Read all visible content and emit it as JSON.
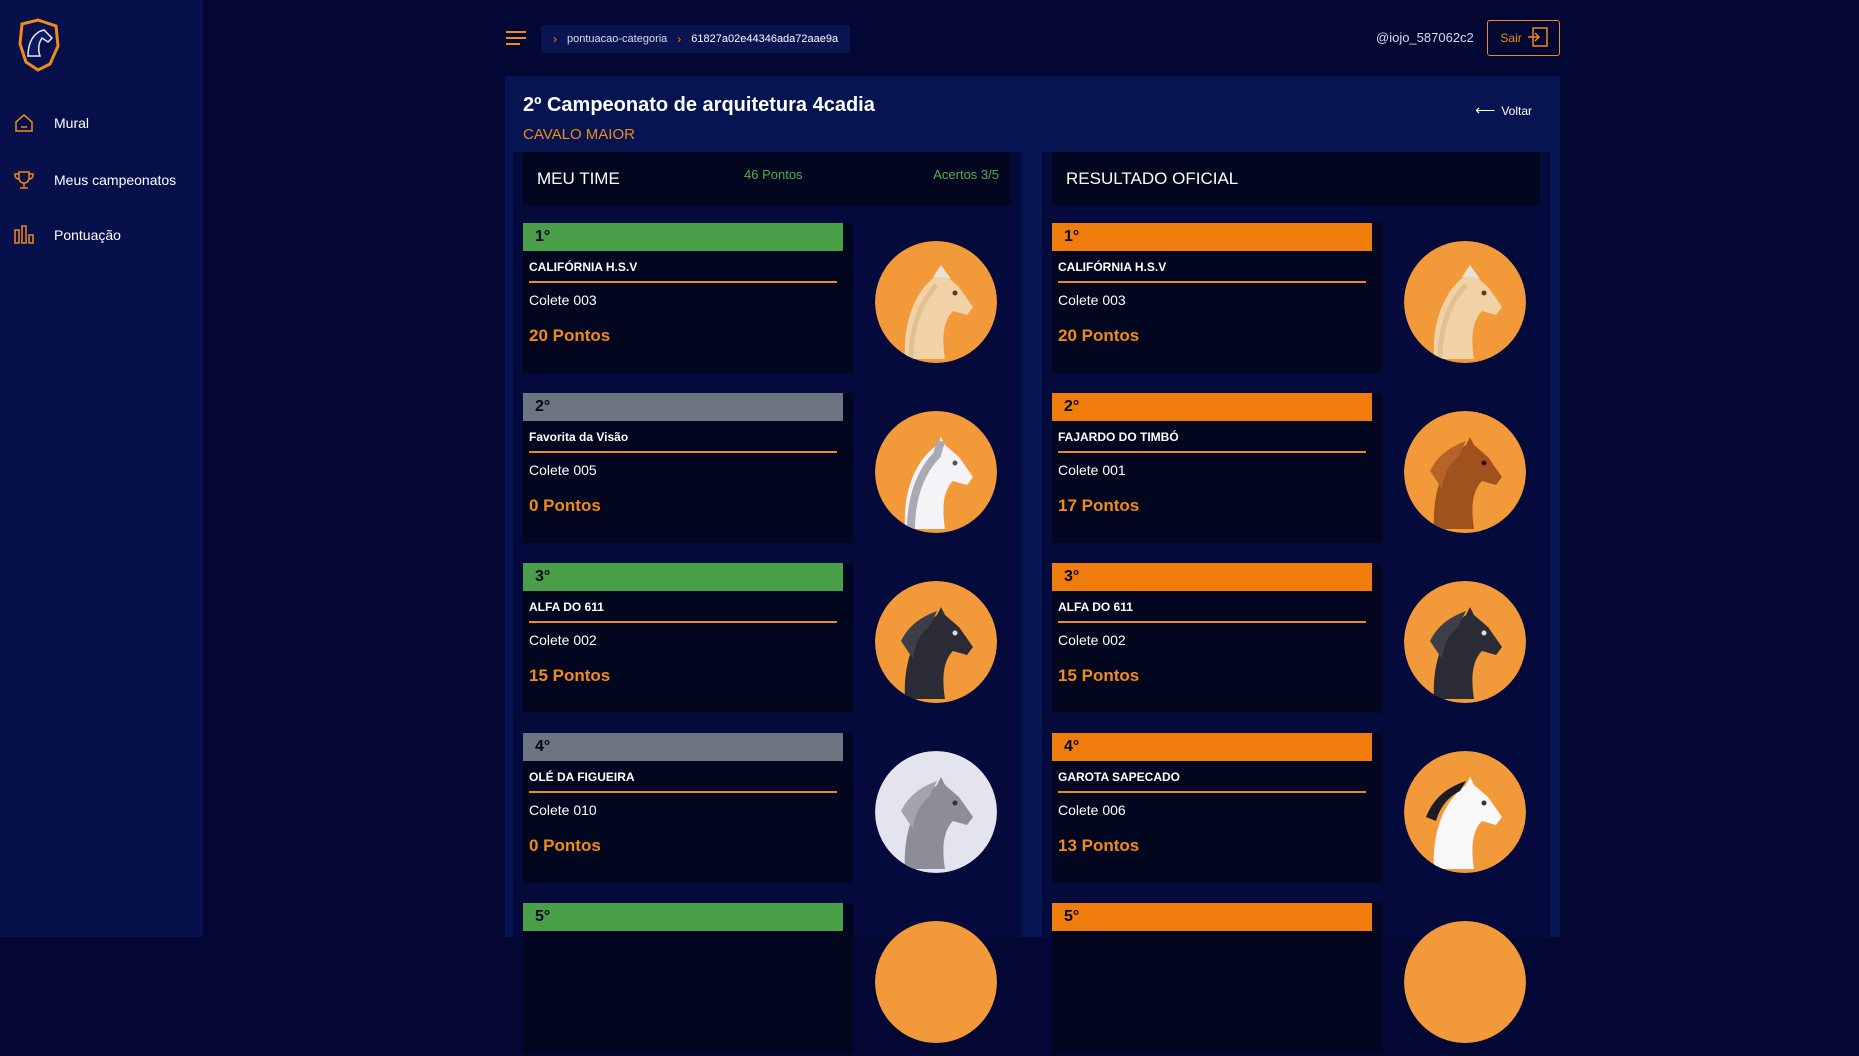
{
  "sidebar": {
    "items": [
      {
        "label": "Mural"
      },
      {
        "label": "Meus campeonatos"
      },
      {
        "label": "Pontuação"
      }
    ]
  },
  "topbar": {
    "breadcrumb": [
      "pontuacao-categoria",
      "61827a02e44346ada72aae9a"
    ],
    "user": "@iojo_587062c2",
    "logout_label": "Sair"
  },
  "page": {
    "title": "2º Campeonato de arquitetura 4cadia",
    "subtitle": "CAVALO MAIOR",
    "back_label": "Voltar"
  },
  "my_team": {
    "title": "MEU TIME",
    "points": "46 Pontos",
    "hits": "Acertos 3/5",
    "entries": [
      {
        "place": "1°",
        "name": "CALIFÓRNIA H.S.V",
        "colete": "Colete 003",
        "points": "20 Pontos"
      },
      {
        "place": "2°",
        "name": "Favorita da Visão",
        "colete": "Colete 005",
        "points": "0 Pontos"
      },
      {
        "place": "3°",
        "name": "ALFA DO 611",
        "colete": "Colete 002",
        "points": "15 Pontos"
      },
      {
        "place": "4°",
        "name": "OLÉ DA FIGUEIRA",
        "colete": "Colete 010",
        "points": "0 Pontos"
      },
      {
        "place": "5°",
        "name": "",
        "colete": "",
        "points": ""
      }
    ]
  },
  "official": {
    "title": "RESULTADO OFICIAL",
    "entries": [
      {
        "place": "1°",
        "name": "CALIFÓRNIA H.S.V",
        "colete": "Colete 003",
        "points": "20 Pontos"
      },
      {
        "place": "2°",
        "name": "FAJARDO DO TIMBÓ",
        "colete": "Colete 001",
        "points": "17 Pontos"
      },
      {
        "place": "3°",
        "name": "ALFA DO 611",
        "colete": "Colete 002",
        "points": "15 Pontos"
      },
      {
        "place": "4°",
        "name": "GAROTA SAPECADO",
        "colete": "Colete 006",
        "points": "13 Pontos"
      },
      {
        "place": "5°",
        "name": "",
        "colete": "",
        "points": ""
      }
    ]
  },
  "colors": {
    "accent": "#f08a1a",
    "hit_green": "#49a049",
    "miss_gray": "#6b7681",
    "official_orange": "#f07d0b",
    "background": "#030733"
  },
  "icons": [
    "logo-horse-icon",
    "home-icon",
    "trophy-icon",
    "bar-chart-icon",
    "menu-icon",
    "chevron-right-icon",
    "logout-icon",
    "arrow-left-icon",
    "horse-head-icon"
  ]
}
